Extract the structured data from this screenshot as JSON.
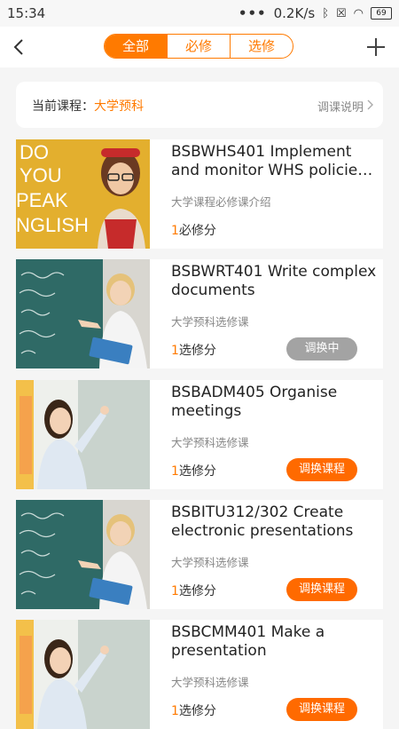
{
  "status_bar": {
    "time": "15:34",
    "speed": "0.2K/s",
    "battery": "69"
  },
  "header": {
    "tabs": [
      {
        "label": "全部"
      },
      {
        "label": "必修"
      },
      {
        "label": "选修"
      }
    ]
  },
  "course_bar": {
    "label": "当前课程：",
    "value": "大学预科",
    "note": "调课说明"
  },
  "courses": [
    {
      "title": "BSBWHS401 Implement and monitor WHS policies, p...",
      "subtitle": "大学课程必修课介绍",
      "credit_num": "1",
      "credit_label": "必修分",
      "button": ""
    },
    {
      "title": "BSBWRT401 Write complex documents",
      "subtitle": "大学预科选修课",
      "credit_num": "1",
      "credit_label": "选修分",
      "button": "调换中"
    },
    {
      "title": "BSBADM405 Organise meetings",
      "subtitle": "大学预科选修课",
      "credit_num": "1",
      "credit_label": "选修分",
      "button": "调换课程"
    },
    {
      "title": "BSBITU312/302 Create electronic presentations",
      "subtitle": "大学预科选修课",
      "credit_num": "1",
      "credit_label": "选修分",
      "button": "调换课程"
    },
    {
      "title": "BSBCMM401 Make a presentation",
      "subtitle": "大学预科选修课",
      "credit_num": "1",
      "credit_label": "选修分",
      "button": "调换课程"
    }
  ],
  "thumbnails": {
    "english": [
      "DO",
      "YOU",
      "PEAK",
      "NGLISH"
    ]
  }
}
